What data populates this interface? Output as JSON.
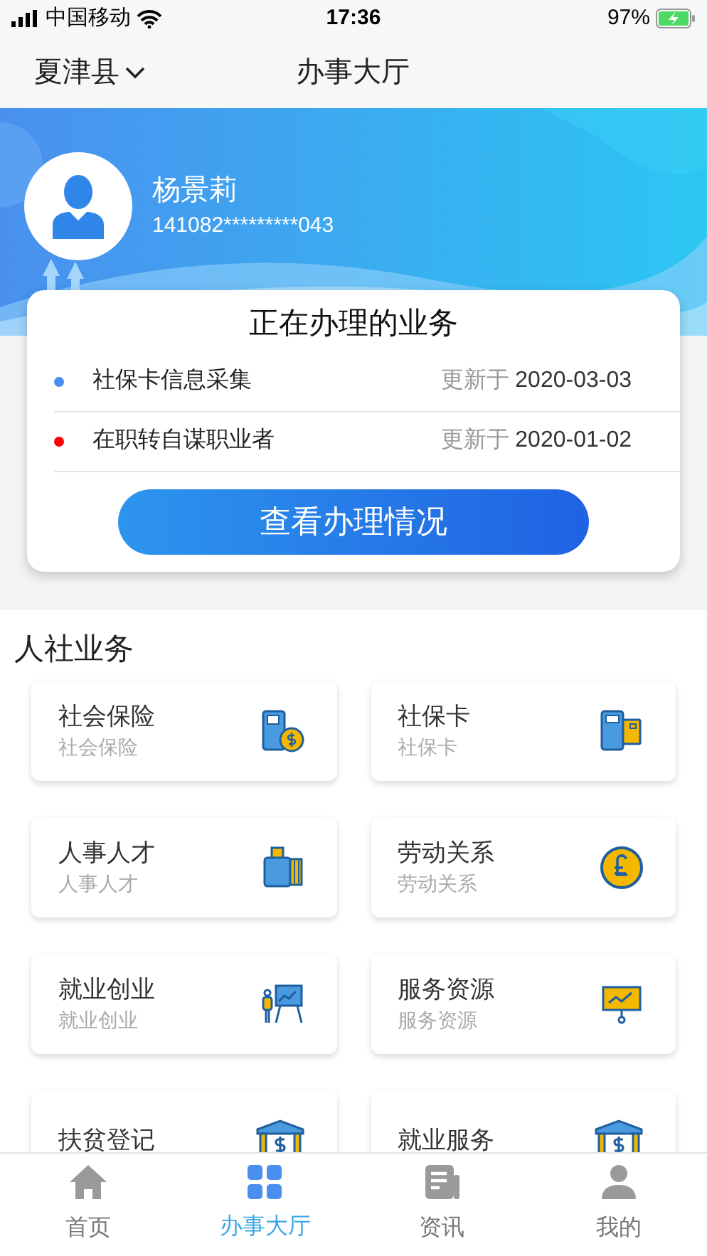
{
  "status_bar": {
    "carrier": "中国移动",
    "time": "17:36",
    "battery": "97%"
  },
  "nav": {
    "location": "夏津县",
    "title": "办事大厅"
  },
  "profile": {
    "name": "杨景莉",
    "id_number": "141082*********043"
  },
  "in_progress": {
    "title": "正在办理的业务",
    "items": [
      {
        "name": "社保卡信息采集",
        "updated_label": "更新于",
        "date": "2020-03-03",
        "color": "#4a8ef0"
      },
      {
        "name": "在职转自谋职业者",
        "updated_label": "更新于",
        "date": "2020-01-02",
        "color": "#ff0000"
      }
    ],
    "button": "查看办理情况"
  },
  "section": {
    "title": "人社业务",
    "services": [
      {
        "title": "社会保险",
        "subtitle": "社会保险"
      },
      {
        "title": "社保卡",
        "subtitle": "社保卡"
      },
      {
        "title": "人事人才",
        "subtitle": "人事人才"
      },
      {
        "title": "劳动关系",
        "subtitle": "劳动关系"
      },
      {
        "title": "就业创业",
        "subtitle": "就业创业"
      },
      {
        "title": "服务资源",
        "subtitle": "服务资源"
      },
      {
        "title": "扶贫登记"
      },
      {
        "title": "就业服务"
      }
    ]
  },
  "tab_bar": [
    {
      "label": "首页",
      "selected": false
    },
    {
      "label": "办事大厅",
      "selected": true
    },
    {
      "label": "资讯",
      "selected": false
    },
    {
      "label": "我的",
      "selected": false
    }
  ]
}
